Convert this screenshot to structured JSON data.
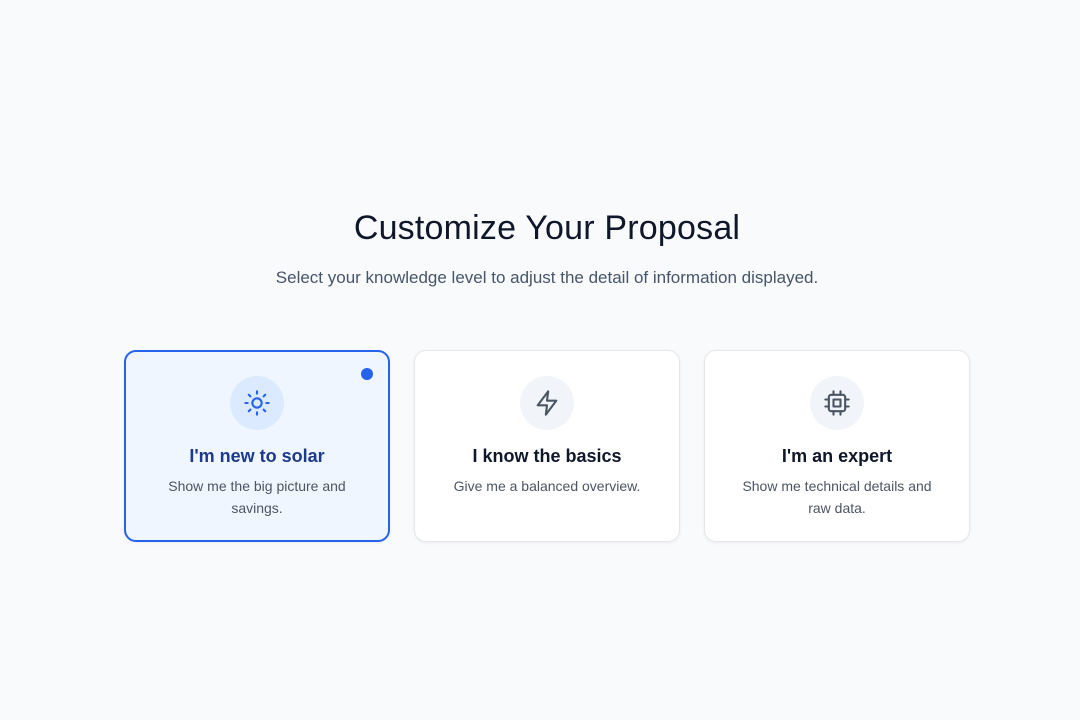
{
  "header": {
    "title": "Customize Your Proposal",
    "subtitle": "Select your knowledge level to adjust the detail of information displayed."
  },
  "options": [
    {
      "icon": "sun-icon",
      "title": "I'm new to solar",
      "description": "Show me the big picture and savings.",
      "selected": true
    },
    {
      "icon": "lightning-bolt-icon",
      "title": "I know the basics",
      "description": "Give me a balanced overview.",
      "selected": false
    },
    {
      "icon": "cpu-chip-icon",
      "title": "I'm an expert",
      "description": "Show me technical details and raw data.",
      "selected": false
    }
  ],
  "colors": {
    "accent": "#2563eb",
    "selected_background": "#eff6ff",
    "selected_title": "#1e3a8a",
    "heading": "#0f172a",
    "body_text": "#4b5563",
    "page_background": "#f8fafc"
  }
}
